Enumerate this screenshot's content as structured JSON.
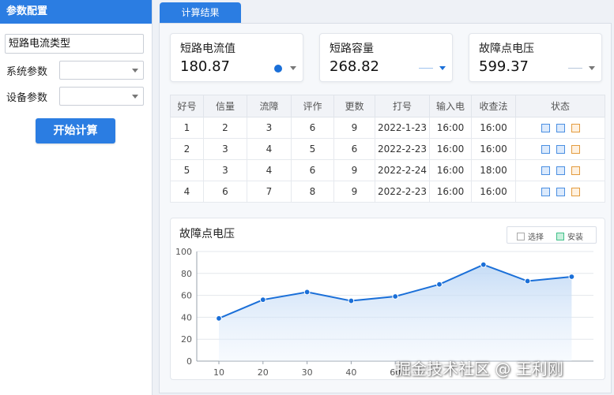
{
  "left": {
    "header": "参数配置",
    "type_label": "短路电流类型",
    "system_label": "系统参数",
    "device_label": "设备参数",
    "start_button": "开始计算"
  },
  "tab": {
    "label": "计算结果"
  },
  "cards": [
    {
      "title": "短路电流值",
      "value": "180.87"
    },
    {
      "title": "短路容量",
      "value": "268.82"
    },
    {
      "title": "故障点电压",
      "value": "599.37"
    }
  ],
  "table": {
    "headers": [
      "好号",
      "信量",
      "流障",
      "评作",
      "更数",
      "打号",
      "输入电",
      "收查法",
      "状态"
    ],
    "rows": [
      [
        "1",
        "2",
        "3",
        "6",
        "9",
        "2022-1-23",
        "16:00",
        "16:00"
      ],
      [
        "2",
        "3",
        "4",
        "5",
        "6",
        "2022-2-23",
        "16:00",
        "16:00"
      ],
      [
        "5",
        "3",
        "4",
        "6",
        "9",
        "2022-2-24",
        "16:00",
        "18:00"
      ],
      [
        "4",
        "6",
        "7",
        "8",
        "9",
        "2022-2-23",
        "16:00",
        "16:00"
      ]
    ]
  },
  "chart_data": {
    "type": "area",
    "title": "故障点电压",
    "x": [
      10,
      20,
      30,
      40,
      50,
      60,
      70,
      80
    ],
    "series": [
      {
        "values": [
          39,
          56,
          63,
          55,
          59,
          70,
          88,
          73,
          77
        ]
      }
    ],
    "ylim": [
      0,
      100
    ],
    "yticks": [
      0,
      20,
      40,
      60,
      80,
      100
    ],
    "xticks_visible": [
      "10",
      "20",
      "30",
      "40",
      "60"
    ],
    "legend": [
      "选择",
      "安装"
    ],
    "legend_position": "top-right",
    "grid": true,
    "line_color": "#1a6fd8"
  },
  "watermark": "掘金技术社区 @ 王利刚"
}
